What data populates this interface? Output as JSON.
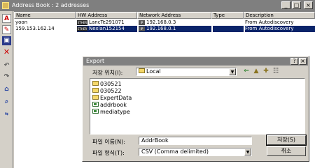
{
  "window": {
    "title": "Address Book : 2 addresses",
    "buttons": [
      "_",
      "□",
      "×"
    ]
  },
  "toolbar": {
    "icons": [
      "add-icon",
      "edit-icon",
      "import-icon",
      "delete-icon",
      "undo-icon",
      "redo-icon",
      "network-icon",
      "find-icon",
      "export-icon"
    ]
  },
  "list": {
    "columns": [
      "Name",
      "HW Address",
      "Network Address",
      "Type",
      "Description"
    ],
    "rows": [
      {
        "name": "yoon",
        "hw": "LancTe291071",
        "net": "192.168.0.3",
        "type": "",
        "desc": "From Autodiscovery",
        "selected": false
      },
      {
        "name": "159.153.162.14",
        "hw": "Nexlan152154",
        "net": "192.168.0.1",
        "type": "",
        "desc": "From Autodiscovery",
        "selected": true
      }
    ]
  },
  "dialog": {
    "title": "Export",
    "save_in_label": "저장 위치(I):",
    "save_in_value": "Local",
    "files": [
      {
        "name": "030521",
        "kind": "folder"
      },
      {
        "name": "030522",
        "kind": "folder"
      },
      {
        "name": "ExpertData",
        "kind": "folder"
      },
      {
        "name": "addrbook",
        "kind": "file"
      },
      {
        "name": "mediatype",
        "kind": "file"
      }
    ],
    "filename_label": "파일 이름(N):",
    "filename_value": "AddrBook",
    "filetype_label": "파일 형식(T):",
    "filetype_value": "CSV (Comma delimited)",
    "save_button": "저장(S)",
    "cancel_button": "취소",
    "title_buttons": [
      "?",
      "×"
    ]
  }
}
